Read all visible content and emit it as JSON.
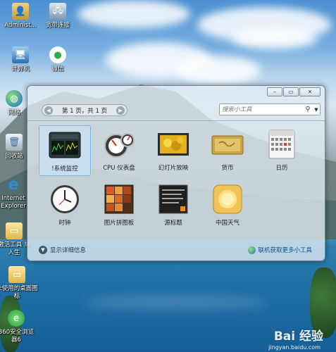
{
  "desktop": {
    "icons": [
      {
        "label": "Administ..."
      },
      {
        "label": "宽带连接"
      },
      {
        "label": "计算机"
      },
      {
        "label": "微信"
      },
      {
        "label": "网络"
      },
      {
        "label": "回收站"
      },
      {
        "label": "Internet Explorer"
      },
      {
        "label": "激活工具 劫人生"
      },
      {
        "label": "未使用的桌面图标"
      },
      {
        "label": "360安全浏览器6"
      }
    ]
  },
  "gadget_window": {
    "controls": {
      "minimize": "–",
      "maximize": "▭",
      "close": "✕"
    },
    "pager": {
      "text": "第 1 页，共 1 页",
      "prev": "◀",
      "next": "▶"
    },
    "search": {
      "placeholder": "搜索小工具"
    },
    "gadgets": [
      {
        "name": "!系统监控",
        "selected": true
      },
      {
        "name": "CPU 仪表盘",
        "selected": false
      },
      {
        "name": "幻灯片放映",
        "selected": false
      },
      {
        "name": "货币",
        "selected": false
      },
      {
        "name": "日历",
        "selected": false
      },
      {
        "name": "时钟",
        "selected": false
      },
      {
        "name": "图片拼图板",
        "selected": false
      },
      {
        "name": "源标题",
        "selected": false
      },
      {
        "name": "中国天气",
        "selected": false
      }
    ],
    "details_label": "显示详细信息",
    "online_label": "联机获取更多小工具"
  },
  "watermark": {
    "brand": "Bai 经验",
    "url": "jingyan.baidu.com"
  }
}
